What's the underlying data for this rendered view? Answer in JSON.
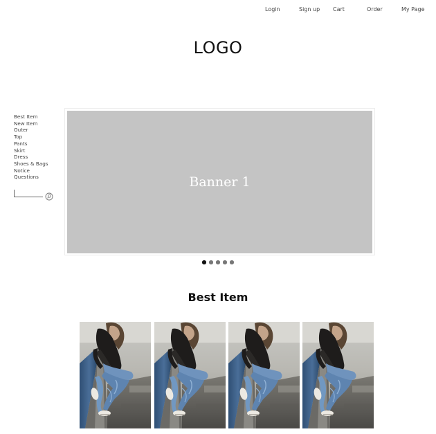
{
  "topnav": {
    "login": "Login",
    "signup": "Sign up",
    "cart": "Cart",
    "order": "Order",
    "mypage": "My Page"
  },
  "logo": "LOGO",
  "sidemenu": {
    "items": [
      "Best Item",
      "New Item",
      "Outer",
      "Top",
      "Pants",
      "Skirt",
      "Dress",
      "Shoes & Bags",
      "Notice",
      "Questions"
    ]
  },
  "search": {
    "value": "",
    "icon": "search-icon"
  },
  "banner": {
    "title": "Banner 1",
    "slide_count": 5,
    "active_slide": 1
  },
  "best_item": {
    "title": "Best Item",
    "product_count": 4
  },
  "colors": {
    "banner_bg": "#c4c4c4",
    "active_dot": "#111111",
    "inactive_dot": "#777777"
  }
}
